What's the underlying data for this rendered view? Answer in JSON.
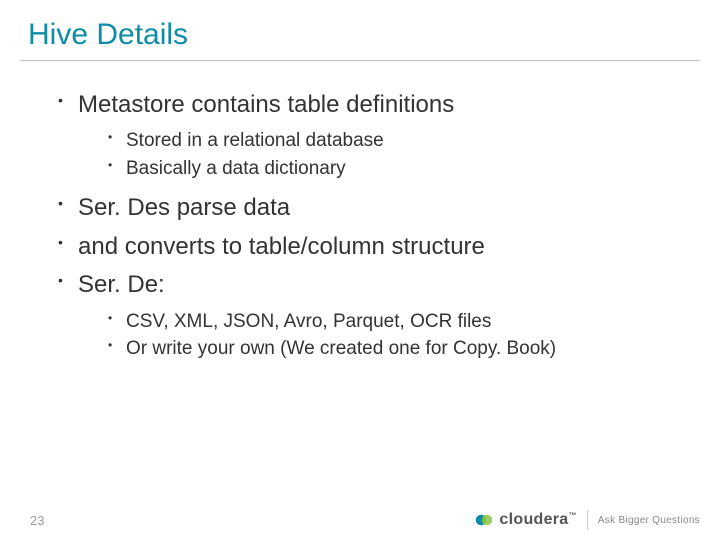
{
  "title": "Hive Details",
  "bullets": {
    "b0": "Metastore contains table definitions",
    "b0_0": "Stored in a relational database",
    "b0_1": "Basically a data dictionary",
    "b1": "Ser. Des parse data",
    "b2": "and converts to table/column structure",
    "b3": "Ser. De:",
    "b3_0": "CSV, XML, JSON, Avro, Parquet, OCR files",
    "b3_1": "Or write your own (We created one for Copy. Book)"
  },
  "page_number": "23",
  "brand": {
    "name": "cloudera",
    "tagline": "Ask Bigger Questions"
  }
}
